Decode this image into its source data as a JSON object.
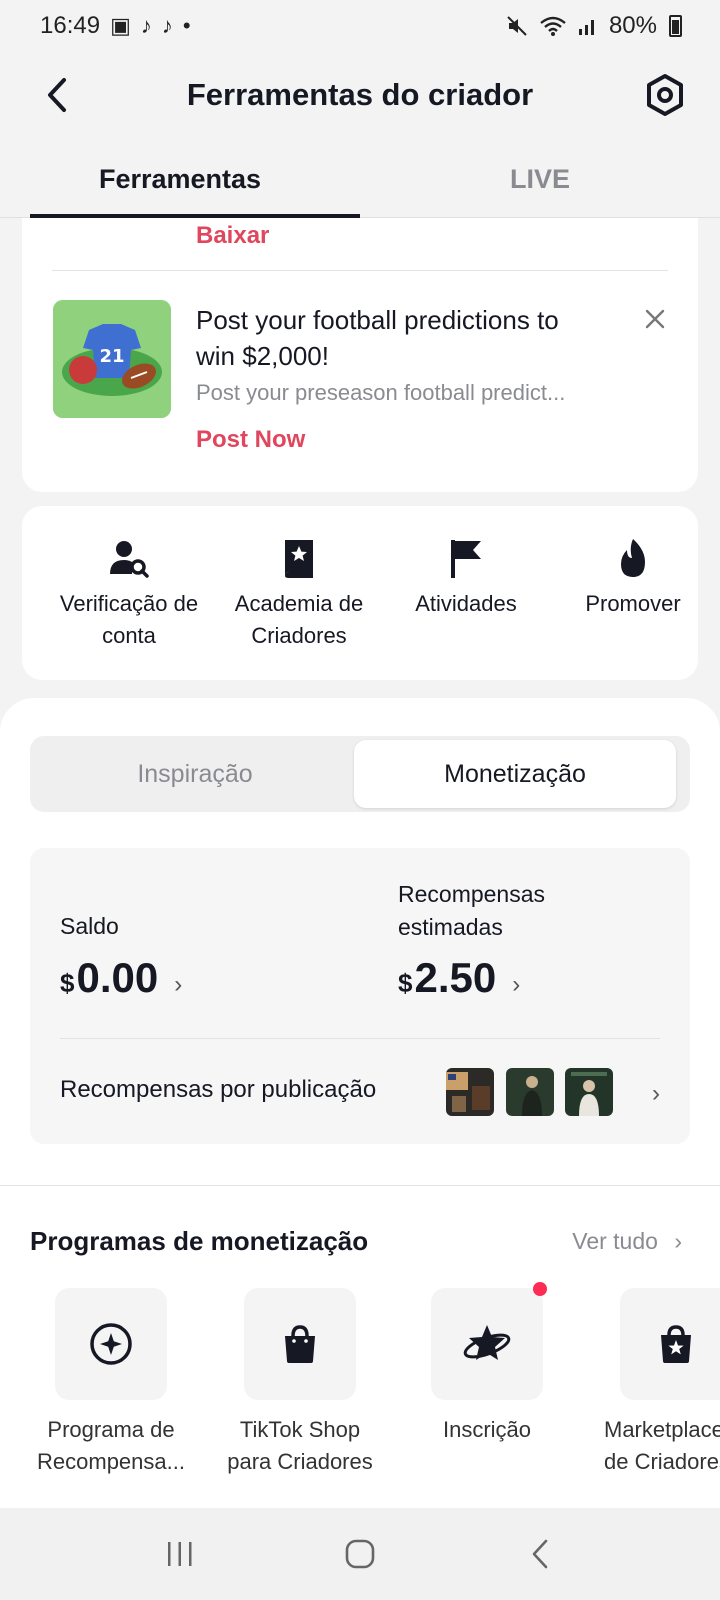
{
  "status_bar": {
    "time": "16:49",
    "battery": "80%"
  },
  "header": {
    "title": "Ferramentas do criador"
  },
  "tabs": [
    {
      "label": "Ferramentas"
    },
    {
      "label": "LIVE"
    }
  ],
  "top_card": {
    "baixar_label": "Baixar"
  },
  "promo": {
    "title": "Post your football predictions to win $2,000!",
    "description": "Post your preseason football predict...",
    "cta": "Post Now",
    "image_text": "21"
  },
  "tools": [
    {
      "label": "Verificação de conta",
      "icon": "person-search-icon"
    },
    {
      "label": "Academia de Criadores",
      "icon": "book-star-icon"
    },
    {
      "label": "Atividades",
      "icon": "flag-icon"
    },
    {
      "label": "Promover",
      "icon": "flame-icon"
    }
  ],
  "segment": {
    "inspiration": "Inspiração",
    "monetization": "Monetização"
  },
  "balance": {
    "label": "Saldo",
    "currency": "$",
    "value": "0.00"
  },
  "rewards": {
    "label": "Recompensas estimadas",
    "currency": "$",
    "value": "2.50"
  },
  "rewards_per_post": {
    "label": "Recompensas por publicação"
  },
  "programs": {
    "title": "Programas de monetização",
    "see_all": "Ver tudo",
    "items": [
      {
        "label_1": "Programa de",
        "label_2": "Recompensa...",
        "icon": "star-circle-icon"
      },
      {
        "label_1": "TikTok Shop",
        "label_2": "para Criadores",
        "icon": "shopping-bag-icon"
      },
      {
        "label_1": "Inscrição",
        "label_2": "",
        "icon": "planet-star-icon"
      },
      {
        "label_1": "Marketplace",
        "label_2": "de Criadores",
        "icon": "bag-star-icon"
      }
    ]
  },
  "colors": {
    "accent": "#e0465e",
    "text": "#161823",
    "muted": "#8a8b91",
    "notification": "#fe2c55"
  }
}
